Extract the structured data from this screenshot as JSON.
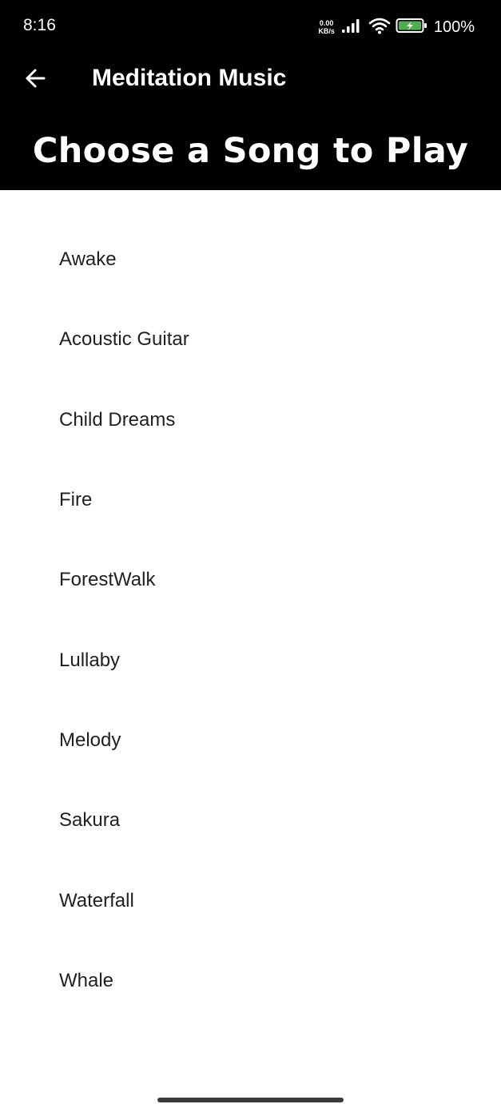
{
  "status_bar": {
    "time": "8:16",
    "net_speed_value": "0.00",
    "net_speed_unit": "KB/s",
    "battery_percent": "100%",
    "battery_color": "#4caf50"
  },
  "app_bar": {
    "back_icon": "arrow-left-icon",
    "title": "Meditation Music"
  },
  "headline": "Choose a Song to Play",
  "songs": [
    "Awake",
    "Acoustic Guitar",
    "Child Dreams",
    "Fire",
    "ForestWalk",
    "Lullaby",
    "Melody",
    "Sakura",
    "Waterfall",
    "Whale"
  ],
  "colors": {
    "header_background": "#000000",
    "header_text": "#ffffff",
    "list_text": "#212121",
    "background": "#ffffff"
  }
}
